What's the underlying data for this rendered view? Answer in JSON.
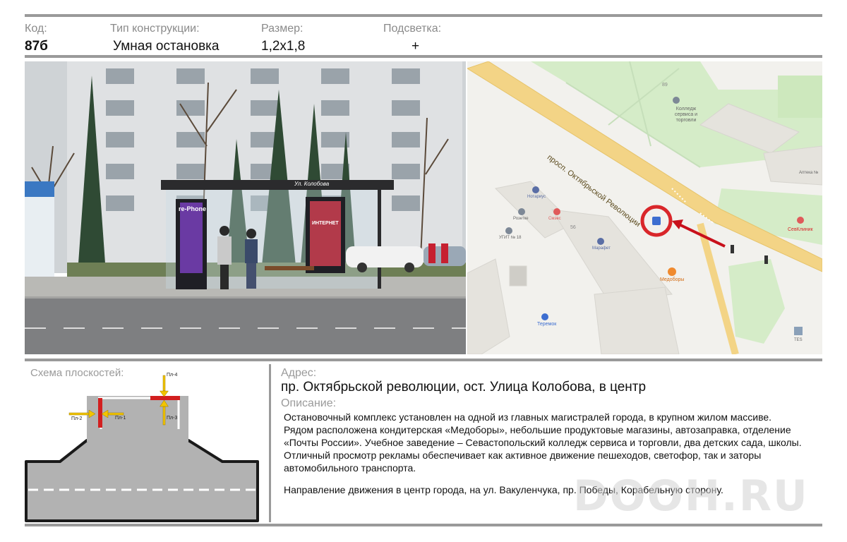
{
  "header": {
    "code_label": "Код:",
    "code_value": "87б",
    "type_label": "Тип конструкции:",
    "type_value": "Умная остановка",
    "size_label": "Размер:",
    "size_value": "1,2х1,8",
    "light_label": "Подсветка:",
    "light_value": "+"
  },
  "photo": {
    "shelter_sign": "Ул. Колобова",
    "ad_left_brand": "re-Phone",
    "ad_right_text": "ИНТЕРНЕТ"
  },
  "map": {
    "street_label": "просп. Октябрьской Революции",
    "poi": [
      "Колледж сервиса и торговли",
      "Аптека №",
      "СевКлиник",
      "Нотариус",
      "Смэвс",
      "Розетке",
      "УГИТ № 18",
      "Марафет",
      "Медоборы",
      "Теремок",
      "TES"
    ],
    "house_numbers": [
      "89",
      "56"
    ],
    "colors": {
      "park": "#d5ecc8",
      "road": "#f3d486",
      "marker": "#d9262a",
      "arrow": "#c8101b"
    }
  },
  "schema": {
    "title": "Схема плоскостей:",
    "planes": [
      "Пл-1",
      "Пл-2",
      "Пл-3",
      "Пл-4"
    ]
  },
  "address": {
    "label": "Адрес:",
    "value": "пр. Октябрьской революции, ост. Улица Колобова, в центр"
  },
  "description": {
    "label": "Описание:",
    "lines": [
      "Остановочный комплекс установлен на одной из главных  магистралей города, в крупном жилом массиве.",
      "Рядом расположена кондитерская «Медоборы», небольшие продуктовые магазины, автозаправка, отделение",
      "«Почты России». Учебное заведение – Севастопольский колледж сервиса и торговли, два детских сада, школы.",
      "Отличный просмотр рекламы обеспечивает как активное движение пешеходов, светофор, так и заторы",
      "автомобильного транспорта."
    ],
    "direction": "Направление движения в центр города, на ул. Вакуленчука, пр. Победы, Корабельную сторону."
  },
  "watermark": "DOOH.RU"
}
